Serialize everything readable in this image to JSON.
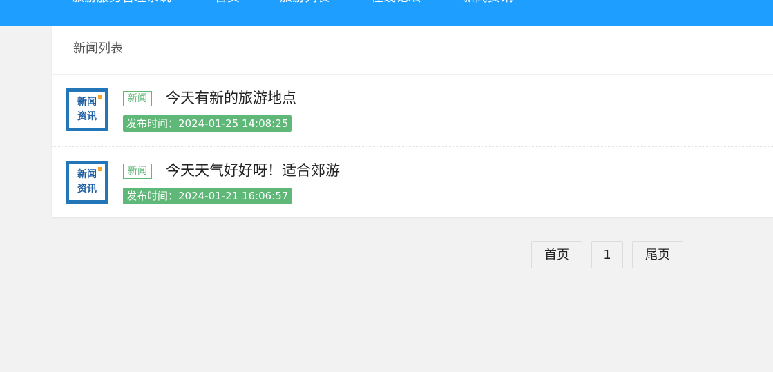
{
  "nav": {
    "items": [
      {
        "label": "旅游服务管理系统"
      },
      {
        "label": "首页"
      },
      {
        "label": "旅游列表"
      },
      {
        "label": "在线论坛"
      },
      {
        "label": "新闻资讯"
      }
    ]
  },
  "panel": {
    "title": "新闻列表"
  },
  "news": [
    {
      "thumb_line1": "新闻",
      "thumb_line2": "资讯",
      "tag": "新闻",
      "title": "今天有新的旅游地点",
      "time": "发布时间：2024-01-25 14:08:25"
    },
    {
      "thumb_line1": "新闻",
      "thumb_line2": "资讯",
      "tag": "新闻",
      "title": "今天天气好好呀！适合郊游",
      "time": "发布时间：2024-01-21 16:06:57"
    }
  ],
  "pagination": {
    "first_label": "首页",
    "current_page": "1",
    "last_label": "尾页"
  },
  "colors": {
    "header_blue": "#1e9fff",
    "tag_green": "#5fb878"
  }
}
